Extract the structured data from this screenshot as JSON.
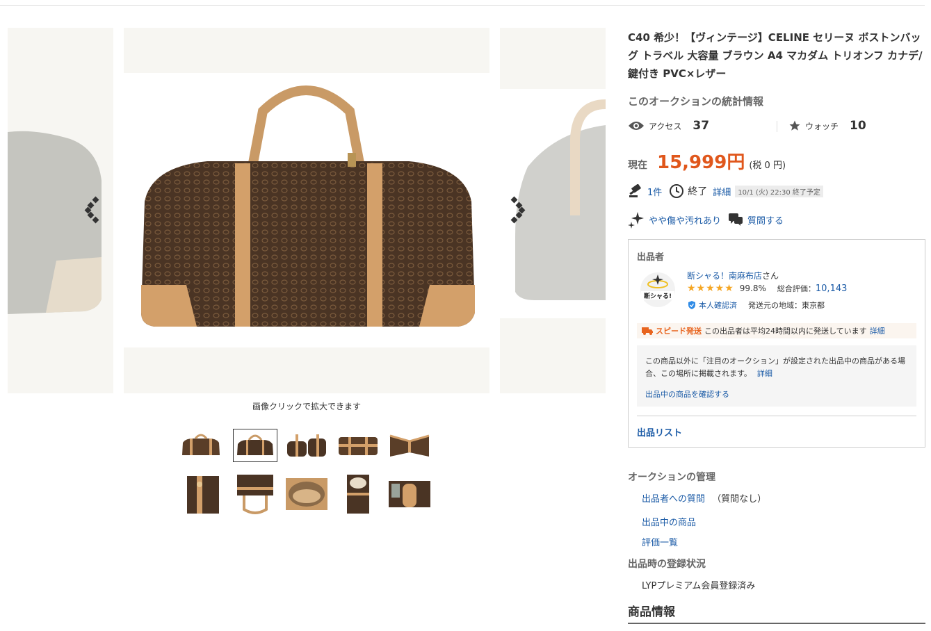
{
  "gallery": {
    "caption": "画像クリックで拡大できます",
    "thumbnail_count": 10,
    "selected_index": 1
  },
  "item": {
    "title": "C40 希少！【ヴィンテージ】CELINE セリーヌ ボストンバッグ トラベル 大容量 ブラウン A4 マカダム トリオンフ カナデ/鍵付き PVC×レザー"
  },
  "stats": {
    "heading": "このオークションの統計情報",
    "access_label": "アクセス",
    "access_value": "37",
    "watch_label": "ウォッチ",
    "watch_value": "10"
  },
  "price": {
    "label": "現在",
    "value": "15,999円",
    "tax": "(税 0 円)"
  },
  "bid": {
    "count": "1件",
    "end_label": "終了",
    "detail_link": "詳細",
    "end_time": "10/1 (火) 22:30 終了予定"
  },
  "condition": {
    "label": "やや傷や汚れあり",
    "question_link": "質問する"
  },
  "seller": {
    "heading": "出品者",
    "name": "断シャる！南麻布店",
    "name_suffix": "さん",
    "avatar_text": "断シャる!",
    "stars": 5,
    "positive_rate": "99.8%",
    "total_label": "総合評価：",
    "total_value": "10,143",
    "verified": "本人確認済",
    "region": "発送元の地域：東京都",
    "speed_label": "スピード発送",
    "speed_text": "この出品者は平均24時間以内に発送しています",
    "speed_link": "詳細",
    "notice_text": "この商品以外に「注目のオークション」が設定された出品中の商品がある場合、この場所に掲載されます。",
    "notice_detail": "詳細",
    "notice_link": "出品中の商品を確認する",
    "list_link": "出品リスト"
  },
  "management": {
    "heading": "オークションの管理",
    "question_link": "出品者への質問",
    "question_note": "（質問なし）",
    "listing_link": "出品中の商品",
    "ratings_link": "評価一覧"
  },
  "registration": {
    "heading": "出品時の登録状況",
    "value": "LYPプレミアム会員登録済み"
  },
  "product_info": {
    "heading": "商品情報"
  },
  "colors": {
    "price": "#e0571c",
    "link": "#1a5aa6",
    "star": "#f5a623",
    "speed": "#e8641e"
  }
}
